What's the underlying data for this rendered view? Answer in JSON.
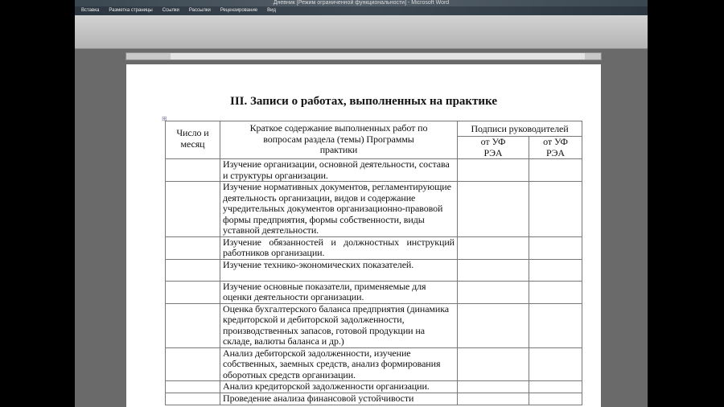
{
  "window": {
    "title": "Дневник [Режим ограниченной функциональности] - Microsoft Word"
  },
  "tabs": [
    "Вставка",
    "Разметка страницы",
    "Ссылки",
    "Рассылки",
    "Рецензирование",
    "Вид"
  ],
  "document": {
    "heading": "III.  Записи о работах, выполненных на практике",
    "table": {
      "headers": {
        "date": "Число и месяц",
        "content": "Краткое содержание выполненных работ по вопросам раздела (темы) Программы практики",
        "signatures": "Подписи руководителей",
        "sig1": "от УФ РЭА",
        "sig2": "от УФ РЭА"
      },
      "rows": [
        "Изучение организации, основной деятельности, состава и структуры организации.",
        "Изучение нормативных документов, регламентирующие деятельность организации, видов и содержание  учредительных документов организационно-правовой формы предприятия, формы собственности, виды уставной деятельности.",
        "Изучение обязанностей и должностных инструкций работников организации.",
        "Изучение технико-экономических показателей.",
        "Изучение основные показатели, применяемые для оценки деятельности организации.",
        "Оценка бухгалтерского баланса предприятия (динамика кредиторской и дебиторской задолженности, производственных запасов, готовой продукции на складе, валюты баланса и др.)",
        "Анализ дебиторской задолженности, изучение собственных, заемных средств, анализ формирования оборотных средств организации.",
        "Анализ кредиторской задолженности организации.",
        "Проведение анализа финансовой устойчивости"
      ]
    }
  }
}
